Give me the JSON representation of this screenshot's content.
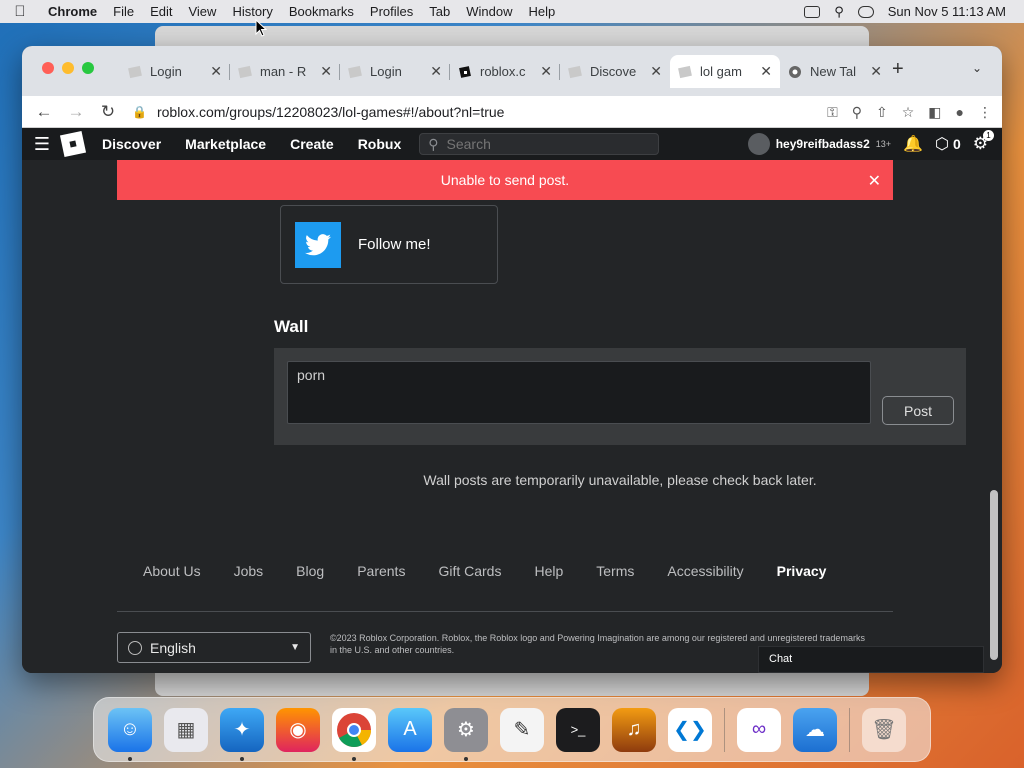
{
  "menubar": {
    "app": "Chrome",
    "items": [
      "File",
      "Edit",
      "View",
      "History",
      "Bookmarks",
      "Profiles",
      "Tab",
      "Window",
      "Help"
    ],
    "datetime": "Sun Nov 5  11:13 AM"
  },
  "browser": {
    "tabs": [
      {
        "title": "Login",
        "icon": "roblox-page-icon"
      },
      {
        "title": "man - R",
        "icon": "roblox-page-icon"
      },
      {
        "title": "Login",
        "icon": "roblox-page-icon"
      },
      {
        "title": "roblox.c",
        "icon": "roblox-logo-icon"
      },
      {
        "title": "Discove",
        "icon": "roblox-page-icon"
      },
      {
        "title": "lol gam",
        "icon": "roblox-page-icon",
        "active": true
      },
      {
        "title": "New Tal",
        "icon": "chrome-icon"
      }
    ],
    "url": "roblox.com/groups/12208023/lol-games#!/about?nl=true"
  },
  "nav": {
    "links": [
      "Discover",
      "Marketplace",
      "Create",
      "Robux"
    ],
    "search_placeholder": "Search",
    "username": "hey9reifbadass2",
    "age_badge": "13+",
    "robux": "0",
    "settings_badge": "1"
  },
  "alert": {
    "message": "Unable to send post."
  },
  "social": {
    "label": "Follow me!"
  },
  "wall": {
    "heading": "Wall",
    "input_value": "porn",
    "post_label": "Post",
    "unavailable": "Wall posts are temporarily unavailable, please check back later."
  },
  "footer": {
    "links": [
      "About Us",
      "Jobs",
      "Blog",
      "Parents",
      "Gift Cards",
      "Help",
      "Terms",
      "Accessibility",
      "Privacy"
    ],
    "language": "English",
    "copyright": "©2023 Roblox Corporation. Roblox, the Roblox logo and Powering Imagination are among our registered and unregistered trademarks in the U.S. and other countries."
  },
  "chat": {
    "label": "Chat"
  },
  "colors": {
    "alert": "#f74b52",
    "twitter": "#1d9bf0",
    "page_bg": "#232527",
    "nav_bg": "#191b1d"
  },
  "dock": [
    "finder-icon",
    "launchpad-icon",
    "safari-icon",
    "firefox-icon",
    "chrome-icon",
    "app-store-icon",
    "system-settings-icon",
    "textedit-icon",
    "terminal-icon",
    "garageband-icon",
    "vscode-icon",
    "visual-studio-icon",
    "weather-icon",
    "trash-icon"
  ]
}
